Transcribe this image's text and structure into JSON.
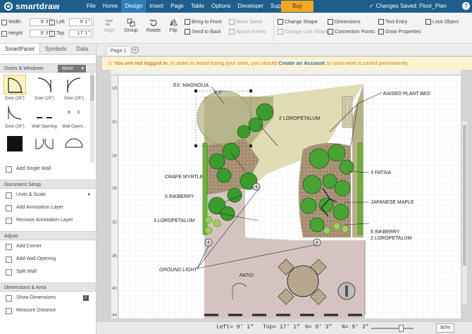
{
  "app": {
    "logo": "smartdraw"
  },
  "menu": [
    "File",
    "Home",
    "Design",
    "Insert",
    "Page",
    "Table",
    "Options",
    "Developer",
    "Support"
  ],
  "buy_label": "Buy",
  "saved_status": "Changes Saved: Floor_Plan",
  "toolbar": {
    "width_label": "Width",
    "width_value": "9' 3\"",
    "height_label": "Height",
    "height_value": "9' 3\"",
    "left_label": "Left",
    "left_value": "9' 1\"",
    "top_label": "Top",
    "top_value": "17' 1\"",
    "align": "Align",
    "group": "Group",
    "rotate": "Rotate",
    "flip": "Flip",
    "bring_front": "Bring to Front",
    "send_back": "Send to Back",
    "make_same": "Make Same",
    "space_evenly": "Space Evenly",
    "change_shape": "Change Shape",
    "change_line_shape": "Change Line Shape",
    "dimensions": "Dimensions",
    "connection_points": "Connection Points",
    "text_entry": "Text Entry",
    "grow_properties": "Grow Properties",
    "lock_object": "Lock Object"
  },
  "panel": {
    "tabs": [
      "SmartPanel",
      "Symbols",
      "Data"
    ],
    "close": "×",
    "doors_title": "Doors & Windows",
    "more": "More",
    "shapes": [
      "Door (28\")",
      "Door (28\")",
      "Door (28\")",
      "Door (28\")",
      "Wall Opening",
      "Wall Openi..."
    ],
    "add_single_wall": "Add Single Wall",
    "doc_setup_title": "Document Setup",
    "units_scale": "Units & Scale",
    "add_annotation": "Add Annotation Layer",
    "remove_annotation": "Remove Annotation Layer",
    "adjust_title": "Adjust",
    "add_corner": "Add Corner",
    "add_wall_opening": "Add Wall Opening",
    "split_wall": "Split Wall",
    "dim_area_title": "Dimensions & Area",
    "show_dimensions": "Show Dimensions",
    "show_dimensions_checked": "✓",
    "measure_distance": "Measure Distance"
  },
  "page_tab": "Page 1",
  "add_page": "+",
  "notice": {
    "bold": "You are not logged in.",
    "pre": " In order to avoid losing your work, you should ",
    "link": "Create an Account",
    "post": " so your work is saved permanently."
  },
  "ruler_labels": [
    "18",
    "20",
    "24",
    "26",
    "32",
    "36",
    "40",
    "44"
  ],
  "plan_labels": {
    "ex_magnolia": "EX. MAGNOLIA",
    "magnolia_dim": "9' 3\"",
    "raised_bed": "RAISED PLANT BED",
    "loropetalum_2a": "2 LOROPETALUM",
    "fatsia": "3 FATSIA",
    "crape_myrtle": "CRAPE MYRTLE",
    "inkberry_5a": "5 INKBERRY",
    "japanese_maple": "JAPANESE MAPLE",
    "loropetalum_3": "3 LOROPETALUM",
    "inkberry_5b": "5 INKBERRY",
    "loropetalum_2b": "2 LOROPETALUM",
    "ground_light": "GROUND LIGHT",
    "patio": "PATIO"
  },
  "status": {
    "left": "Left= 9' 1\"",
    "top": "Top= 17' 1\"",
    "h": "H= 9' 3\"",
    "n": "N= 9' 3\"",
    "zoom": "90%"
  }
}
